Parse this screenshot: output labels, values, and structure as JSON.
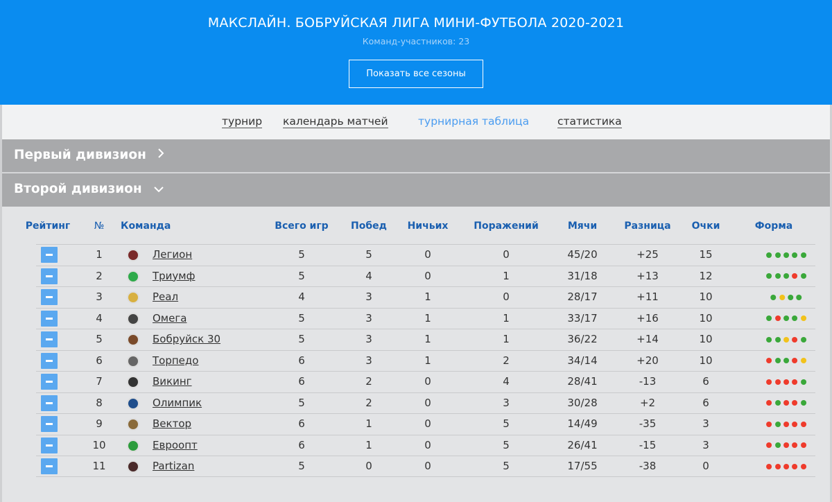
{
  "header": {
    "title": "МАКСЛАЙН. БОБРУЙСКАЯ ЛИГА МИНИ-ФУТБОЛА 2020-2021",
    "subtitle": "Команд-участников: 23",
    "seasons_button": "Показать все сезоны"
  },
  "nav": {
    "items": [
      {
        "label": "турнир",
        "active": false
      },
      {
        "label": "календарь матчей",
        "active": false
      },
      {
        "label": "турнирная таблица",
        "active": true
      },
      {
        "label": "статистика",
        "active": false
      }
    ]
  },
  "divisions": {
    "first": {
      "label": "Первый дивизион",
      "chevron": "›"
    },
    "second": {
      "label": "Второй дивизион",
      "chevron": "⌄"
    }
  },
  "table": {
    "headers": {
      "rating": "Рейтинг",
      "num": "№",
      "team": "Команда",
      "games": "Всего игр",
      "wins": "Побед",
      "draws": "Ничьих",
      "losses": "Поражений",
      "goals": "Мячи",
      "diff": "Разница",
      "points": "Очки",
      "form": "Форма"
    },
    "rows": [
      {
        "num": "1",
        "team": "Легион",
        "logo": "legion-logo-icon",
        "games": "5",
        "wins": "5",
        "draws": "0",
        "losses": "0",
        "goals": "45/20",
        "diff": "+25",
        "points": "15",
        "form": [
          "g",
          "g",
          "g",
          "g",
          "g"
        ]
      },
      {
        "num": "2",
        "team": "Триумф",
        "logo": "triumph-logo-icon",
        "games": "5",
        "wins": "4",
        "draws": "0",
        "losses": "1",
        "goals": "31/18",
        "diff": "+13",
        "points": "12",
        "form": [
          "g",
          "g",
          "g",
          "r",
          "g"
        ]
      },
      {
        "num": "3",
        "team": "Реал",
        "logo": "real-logo-icon",
        "games": "4",
        "wins": "3",
        "draws": "1",
        "losses": "0",
        "goals": "28/17",
        "diff": "+11",
        "points": "10",
        "form": [
          "g",
          "y",
          "g",
          "g"
        ]
      },
      {
        "num": "4",
        "team": "Омега",
        "logo": "omega-logo-icon",
        "games": "5",
        "wins": "3",
        "draws": "1",
        "losses": "1",
        "goals": "33/17",
        "diff": "+16",
        "points": "10",
        "form": [
          "g",
          "r",
          "g",
          "g",
          "y"
        ]
      },
      {
        "num": "5",
        "team": "Бобруйск 30",
        "logo": "bobruisk-logo-icon",
        "games": "5",
        "wins": "3",
        "draws": "1",
        "losses": "1",
        "goals": "36/22",
        "diff": "+14",
        "points": "10",
        "form": [
          "g",
          "g",
          "y",
          "r",
          "g"
        ]
      },
      {
        "num": "6",
        "team": "Торпедо",
        "logo": "torpedo-logo-icon",
        "games": "6",
        "wins": "3",
        "draws": "1",
        "losses": "2",
        "goals": "34/14",
        "diff": "+20",
        "points": "10",
        "form": [
          "r",
          "g",
          "g",
          "r",
          "y"
        ]
      },
      {
        "num": "7",
        "team": "Викинг",
        "logo": "viking-logo-icon",
        "games": "6",
        "wins": "2",
        "draws": "0",
        "losses": "4",
        "goals": "28/41",
        "diff": "-13",
        "points": "6",
        "form": [
          "r",
          "r",
          "r",
          "r",
          "g"
        ]
      },
      {
        "num": "8",
        "team": "Олимпик",
        "logo": "olimpik-logo-icon",
        "games": "5",
        "wins": "2",
        "draws": "0",
        "losses": "3",
        "goals": "30/28",
        "diff": "+2",
        "points": "6",
        "form": [
          "r",
          "g",
          "r",
          "r",
          "g"
        ]
      },
      {
        "num": "9",
        "team": "Вектор",
        "logo": "vector-logo-icon",
        "games": "6",
        "wins": "1",
        "draws": "0",
        "losses": "5",
        "goals": "14/49",
        "diff": "-35",
        "points": "3",
        "form": [
          "r",
          "g",
          "r",
          "r",
          "r"
        ]
      },
      {
        "num": "10",
        "team": "Евроопт",
        "logo": "evroopt-logo-icon",
        "games": "6",
        "wins": "1",
        "draws": "0",
        "losses": "5",
        "goals": "26/41",
        "diff": "-15",
        "points": "3",
        "form": [
          "r",
          "g",
          "r",
          "r",
          "r"
        ]
      },
      {
        "num": "11",
        "team": "Partizan",
        "logo": "partizan-logo-icon",
        "games": "5",
        "wins": "0",
        "draws": "0",
        "losses": "5",
        "goals": "17/55",
        "diff": "-38",
        "points": "0",
        "form": [
          "r",
          "r",
          "r",
          "r",
          "r"
        ]
      }
    ]
  },
  "colors": {
    "header_bg": "#0a8cf0",
    "win": "#3aa83a",
    "draw": "#f2c21b",
    "loss": "#ef3b2c",
    "accent": "#1a5fb0",
    "rank_button": "#5aa8f0"
  }
}
